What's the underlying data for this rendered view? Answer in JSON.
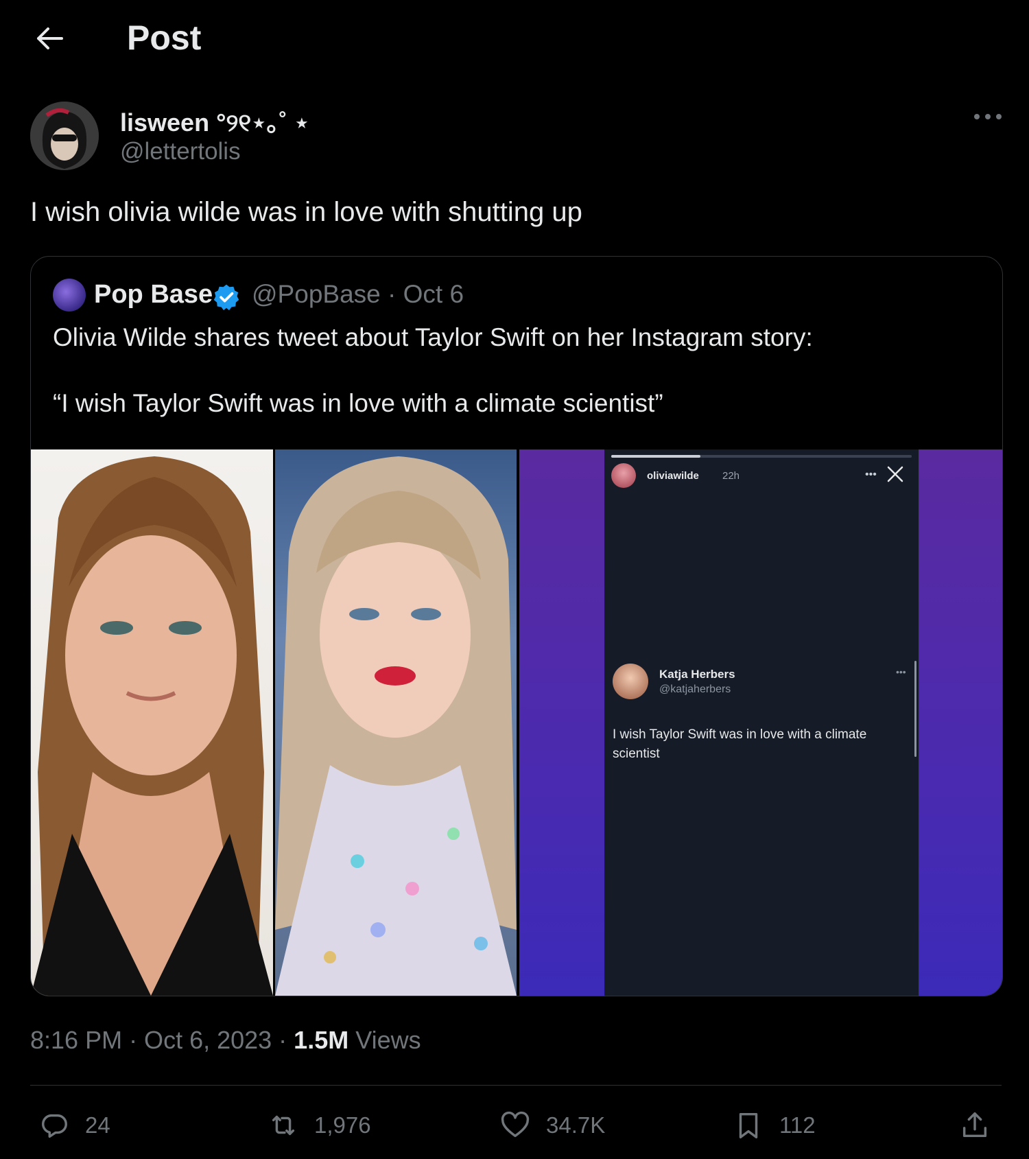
{
  "header": {
    "title": "Post"
  },
  "author": {
    "name": "lisween °୨୧⋆｡˚ ⋆",
    "handle": "@lettertolis"
  },
  "post": {
    "text": "I wish olivia wilde was in love with shutting up"
  },
  "quote": {
    "name": "Pop Base",
    "handle_date": "@PopBase · Oct 6",
    "text_line1": "Olivia Wilde shares tweet about Taylor Swift on her Instagram story:",
    "text_line2": "“I wish Taylor Swift was in love with a climate scientist”",
    "story": {
      "user": "oliviawilde",
      "time": "22h",
      "embed_name": "Katja Herbers",
      "embed_handle": "@katjaherbers",
      "embed_text": "I wish Taylor Swift was in love with a climate scientist"
    }
  },
  "meta": {
    "time_date": "8:16 PM · Oct 6, 2023 · ",
    "views_count": "1.5M",
    "views_label": " Views"
  },
  "actions": {
    "replies": "24",
    "reposts": "1,976",
    "likes": "34.7K",
    "bookmarks": "112"
  },
  "colors": {
    "background": "#000000",
    "text": "#e7e9ea",
    "muted": "#71767b",
    "verified": "#1d9bf0",
    "border": "#2f3336"
  }
}
